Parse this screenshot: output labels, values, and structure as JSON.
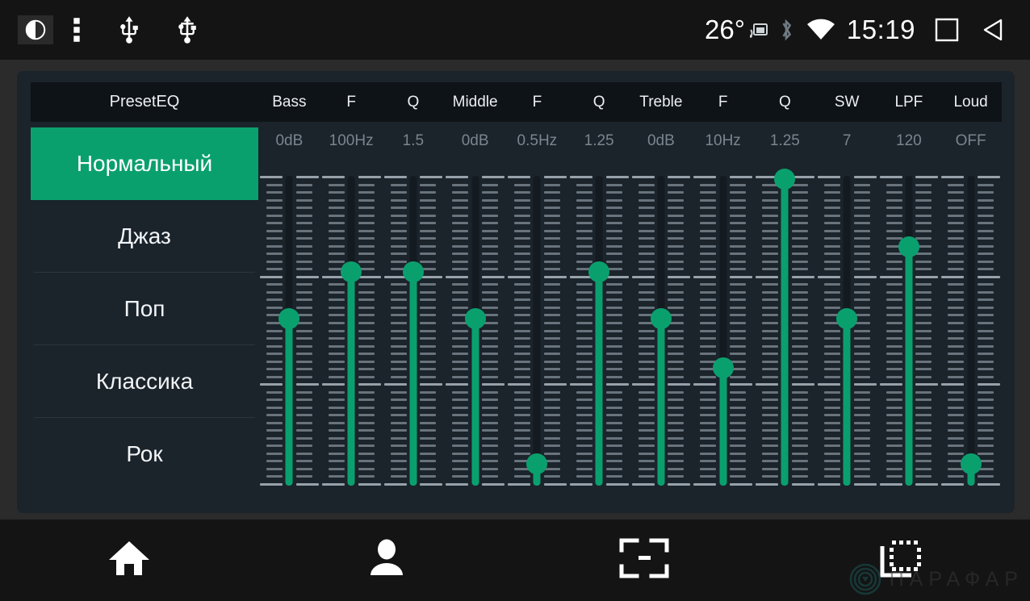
{
  "statusbar": {
    "left_icons": [
      "notification-badge-icon",
      "more-vert-icon",
      "usb-icon",
      "usb-icon"
    ],
    "temperature": "26°",
    "cast_icon": "cast-icon",
    "bluetooth_icon": "bluetooth-icon",
    "wifi_icon": "wifi-icon",
    "time": "15:19",
    "recents_icon": "square-recents-icon",
    "back_icon": "back-triangle-icon",
    "bg_color": "#141414"
  },
  "header": {
    "preset_label": "PresetEQ",
    "columns": [
      "Bass",
      "F",
      "Q",
      "Middle",
      "F",
      "Q",
      "Treble",
      "F",
      "Q",
      "SW",
      "LPF",
      "Loud"
    ]
  },
  "values": [
    "0dB",
    "100Hz",
    "1.5",
    "0dB",
    "0.5Hz",
    "1.25",
    "0dB",
    "10Hz",
    "1.25",
    "7",
    "120",
    "OFF"
  ],
  "presets": {
    "items": [
      {
        "label": "Нормальный",
        "active": true
      },
      {
        "label": "Джаз",
        "active": false
      },
      {
        "label": "Поп",
        "active": false
      },
      {
        "label": "Классика",
        "active": false
      },
      {
        "label": "Рок",
        "active": false
      }
    ],
    "accent_color": "#0aa06e"
  },
  "sliders": {
    "accent_color": "#0aa06e",
    "track_color": "#131a20",
    "tick_color": "#68737c",
    "tick_major_color": "#97a1a9",
    "tick_count": 41,
    "major_tick_indices": [
      0,
      13,
      27,
      40
    ],
    "channels": [
      {
        "name": "Bass",
        "value_label": "0dB",
        "position_pct": 46
      },
      {
        "name": "F",
        "value_label": "100Hz",
        "position_pct": 31
      },
      {
        "name": "Q",
        "value_label": "1.5",
        "position_pct": 31
      },
      {
        "name": "Middle",
        "value_label": "0dB",
        "position_pct": 46
      },
      {
        "name": "F",
        "value_label": "0.5Hz",
        "position_pct": 93
      },
      {
        "name": "Q",
        "value_label": "1.25",
        "position_pct": 31
      },
      {
        "name": "Treble",
        "value_label": "0dB",
        "position_pct": 46
      },
      {
        "name": "F",
        "value_label": "10Hz",
        "position_pct": 62
      },
      {
        "name": "Q",
        "value_label": "1.25",
        "position_pct": 1
      },
      {
        "name": "SW",
        "value_label": "7",
        "position_pct": 46
      },
      {
        "name": "LPF",
        "value_label": "120",
        "position_pct": 23
      },
      {
        "name": "Loud",
        "value_label": "OFF",
        "position_pct": 93
      }
    ]
  },
  "navbar": {
    "buttons": [
      {
        "icon": "home-icon"
      },
      {
        "icon": "person-icon"
      },
      {
        "icon": "minimize-frame-icon"
      },
      {
        "icon": "multi-window-icon"
      }
    ],
    "bg_color": "#141414"
  },
  "watermark": {
    "text": "ПАРАФАР",
    "logo": "target-logo-icon"
  }
}
